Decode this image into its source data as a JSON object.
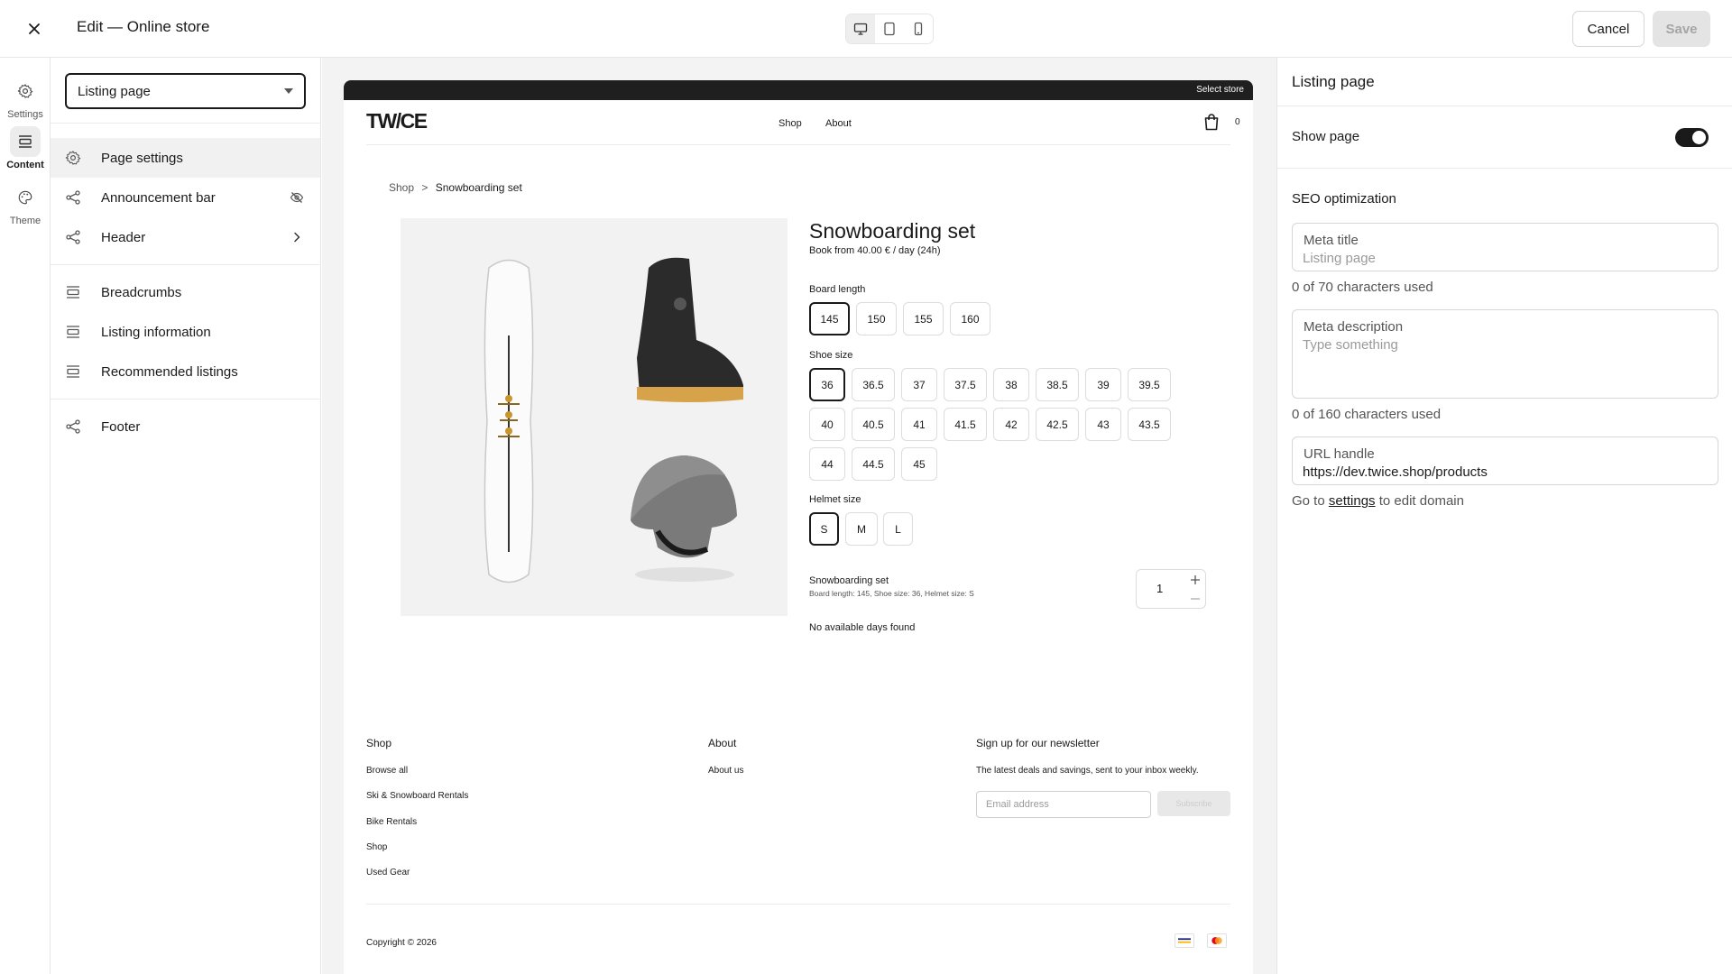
{
  "topbar": {
    "title": "Edit — Online store",
    "cancel_label": "Cancel",
    "save_label": "Save"
  },
  "rail": {
    "items": [
      {
        "label": "Settings",
        "icon": "gear-icon"
      },
      {
        "label": "Content",
        "icon": "sections-icon",
        "active": true
      },
      {
        "label": "Theme",
        "icon": "palette-icon"
      }
    ]
  },
  "sections": {
    "page_select": "Listing page",
    "items": [
      {
        "label": "Page settings",
        "icon": "gear-icon",
        "active": true
      },
      {
        "label": "Announcement bar",
        "icon": "share-nodes-icon",
        "right_icon": "eye-off-icon"
      },
      {
        "label": "Header",
        "icon": "share-nodes-icon",
        "right_icon": "chevron-right-icon"
      },
      {
        "label": "Breadcrumbs",
        "icon": "section-block-icon"
      },
      {
        "label": "Listing information",
        "icon": "section-block-icon"
      },
      {
        "label": "Recommended listings",
        "icon": "section-block-icon"
      },
      {
        "label": "Footer",
        "icon": "share-nodes-icon"
      }
    ]
  },
  "store": {
    "topbar_label": "Select store",
    "logo_text": "TW/CE",
    "nav": [
      "Shop",
      "About"
    ],
    "cart_count": "0",
    "breadcrumb": {
      "parent": "Shop",
      "separator": ">",
      "current": "Snowboarding set"
    },
    "product": {
      "title": "Snowboarding set",
      "price_prefix": "Book from ",
      "price": "40.00 €",
      "price_suffix": " / day (24h)",
      "board_length_label": "Board length",
      "board_lengths": [
        "145",
        "150",
        "155",
        "160"
      ],
      "shoe_size_label": "Shoe size",
      "shoe_sizes": [
        "36",
        "36.5",
        "37",
        "37.5",
        "38",
        "38.5",
        "39",
        "39.5",
        "40",
        "40.5",
        "41",
        "41.5",
        "42",
        "42.5",
        "43",
        "43.5",
        "44",
        "44.5",
        "45"
      ],
      "helmet_size_label": "Helmet size",
      "helmet_sizes": [
        "S",
        "M",
        "L"
      ],
      "summary_name": "Snowboarding set",
      "summary_options": "Board length: 145, Shoe size: 36, Helmet size: S",
      "quantity": "1",
      "availability": "No available days found"
    },
    "footer": {
      "shop_heading": "Shop",
      "shop_links": [
        "Browse all",
        "Ski & Snowboard Rentals",
        "Bike Rentals",
        "Shop",
        "Used Gear"
      ],
      "about_heading": "About",
      "about_links": [
        "About us"
      ],
      "newsletter_heading": "Sign up for our newsletter",
      "newsletter_text": "The latest deals and savings, sent to your inbox weekly.",
      "email_placeholder": "Email address",
      "subscribe_label": "Subscribe",
      "copyright": "Copyright © 2026",
      "payment_icons": [
        "visa-icon",
        "mastercard-icon"
      ]
    }
  },
  "settings": {
    "title": "Listing page",
    "show_page_label": "Show page",
    "show_page_on": true,
    "seo_heading": "SEO optimization",
    "meta_title_label": "Meta title",
    "meta_title_placeholder": "Listing page",
    "meta_title_help": "0 of 70 characters used",
    "meta_desc_label": "Meta description",
    "meta_desc_placeholder": "Type something",
    "meta_desc_help": "0 of 160 characters used",
    "url_label": "URL handle",
    "url_value": "https://dev.twice.shop/products",
    "url_help_prefix": "Go to ",
    "url_help_link": "settings",
    "url_help_suffix": " to edit domain"
  },
  "colors": {
    "accent": "#1a1a1a",
    "logo_slash": "#8a2be2"
  }
}
